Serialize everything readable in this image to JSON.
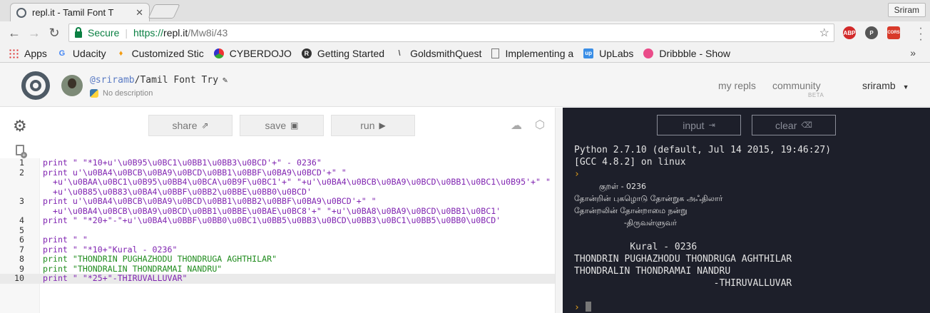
{
  "browser": {
    "tab_title": "repl.it - Tamil Font T",
    "tab_close": "✕",
    "profile": "Sriram",
    "secure_label": "Secure",
    "url_scheme": "https://",
    "url_host": "repl.it",
    "url_path": "/Mw8i/43",
    "extensions": [
      {
        "name": "ABP",
        "color": "#d22a2a"
      },
      {
        "name": "P",
        "color": "#555555"
      },
      {
        "name": "CORS",
        "color": "#d83a2a"
      }
    ],
    "bookmarks": [
      {
        "label": "Apps",
        "icon": "apps-grid-icon"
      },
      {
        "label": "Udacity",
        "icon": "udacity-icon"
      },
      {
        "label": "Customized Stic",
        "icon": "flame-icon"
      },
      {
        "label": "CYBERDOJO",
        "icon": "cyberdojo-icon"
      },
      {
        "label": "Getting Started",
        "icon": "r-icon"
      },
      {
        "label": "GoldsmithQuest",
        "icon": "slash-icon"
      },
      {
        "label": "Implementing a",
        "icon": "page-icon"
      },
      {
        "label": "UpLabs",
        "icon": "uplabs-icon"
      },
      {
        "label": "Dribbble - Show",
        "icon": "dribbble-icon"
      }
    ],
    "bookmarks_more": "»"
  },
  "repl": {
    "user": "@sriramb",
    "name": "/Tamil Font Try",
    "description": "No description",
    "nav": {
      "my_repls": "my repls",
      "community": "community",
      "beta": "BETA",
      "username": "sriramb"
    },
    "buttons": {
      "share": "share",
      "save": "save",
      "run": "run",
      "input": "input",
      "clear": "clear"
    }
  },
  "editor": {
    "lines": [
      {
        "n": "1",
        "text": "print \" \"*10+u'\\u0B95\\u0BC1\\u0BB1\\u0BB3\\u0BCD'+\" - 0236\""
      },
      {
        "n": "2",
        "text": "print u'\\u0BA4\\u0BCB\\u0BA9\\u0BCD\\u0BB1\\u0BBF\\u0BA9\\u0BCD'+\" \""
      },
      {
        "n": "",
        "text": "  +u'\\u0BAA\\u0BC1\\u0B95\\u0BB4\\u0BCA\\u0B9F\\u0BC1'+\" \"+u'\\u0BA4\\u0BCB\\u0BA9\\u0BCD\\u0BB1\\u0BC1\\u0B95'+\" \""
      },
      {
        "n": "",
        "text": "  +u'\\u0B85\\u0B83\\u0BA4\\u0BBF\\u0BB2\\u0BBE\\u0BB0\\u0BCD'"
      },
      {
        "n": "3",
        "text": "print u'\\u0BA4\\u0BCB\\u0BA9\\u0BCD\\u0BB1\\u0BB2\\u0BBF\\u0BA9\\u0BCD'+\" \""
      },
      {
        "n": "",
        "text": "  +u'\\u0BA4\\u0BCB\\u0BA9\\u0BCD\\u0BB1\\u0BBE\\u0BAE\\u0BC8'+\" \"+u'\\u0BA8\\u0BA9\\u0BCD\\u0BB1\\u0BC1'"
      },
      {
        "n": "4",
        "text": "print \" \"*20+\"-\"+u'\\u0BA4\\u0BBF\\u0BB0\\u0BC1\\u0BB5\\u0BB3\\u0BCD\\u0BB3\\u0BC1\\u0BB5\\u0BB0\\u0BCD'"
      },
      {
        "n": "5",
        "text": ""
      },
      {
        "n": "6",
        "text": "print \" \""
      },
      {
        "n": "7",
        "text": "print \" \"*10+\"Kural - 0236\""
      },
      {
        "n": "8",
        "text": "print \"THONDRIN PUGHAZHODU THONDRUGA AGHTHILAR\""
      },
      {
        "n": "9",
        "text": "print \"THONDRALIN THONDRAMAI NANDRU\""
      },
      {
        "n": "10",
        "text": "print \" \"*25+\"-THIRUVALLUVAR\""
      }
    ]
  },
  "console": {
    "header1": "Python 2.7.10 (default, Jul 14 2015, 19:46:27)",
    "header2": "[GCC 4.8.2] on linux",
    "prompt": "›",
    "tamil_title": "          குறள் - 0236",
    "tamil_line1": "தோன்றின் புகழொடு தோன்றுக அஃதிலார்",
    "tamil_line2": "தோன்றலின் தோன்றாமை நன்று",
    "tamil_author": "                    -திருவள்ளுவர்",
    "blank": " ",
    "eng_title": "          Kural - 0236",
    "eng_line1": "THONDRIN PUGHAZHODU THONDRUGA AGHTHILAR",
    "eng_line2": "THONDRALIN THONDRAMAI NANDRU",
    "eng_author": "                         -THIRUVALLUVAR"
  }
}
